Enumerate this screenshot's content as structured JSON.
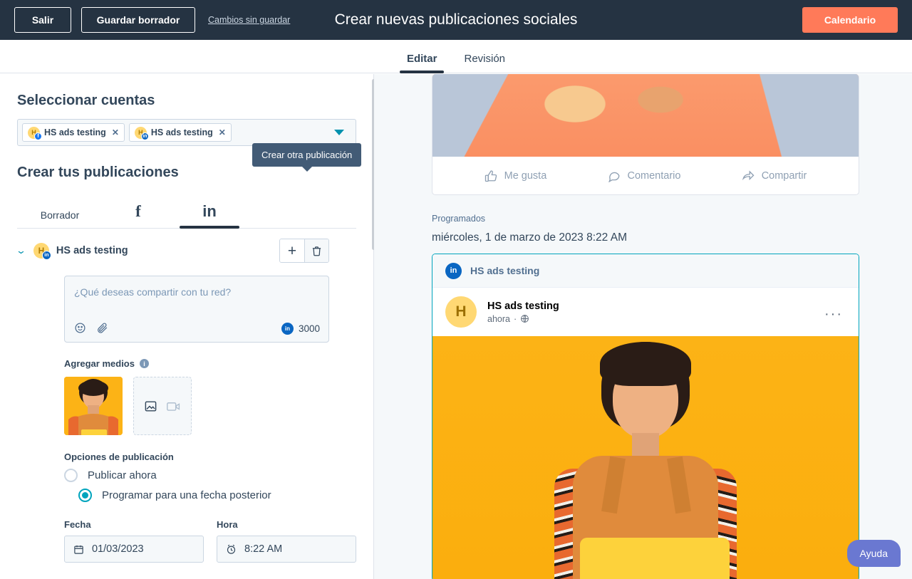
{
  "topbar": {
    "exit_label": "Salir",
    "save_draft_label": "Guardar borrador",
    "unsaved_label": "Cambios sin guardar",
    "title": "Crear nuevas publicaciones sociales",
    "calendar_label": "Calendario",
    "bg_color": "#253342",
    "accent_color": "#ff7a59"
  },
  "tabs": [
    {
      "label": "Editar",
      "active": true
    },
    {
      "label": "Revisión",
      "active": false
    }
  ],
  "left": {
    "accounts_heading": "Seleccionar cuentas",
    "chips": [
      {
        "initial": "H",
        "name": "HS ads testing",
        "network": "f",
        "close": "✕"
      },
      {
        "initial": "H",
        "name": "HS ads testing",
        "network": "in",
        "close": "✕"
      }
    ],
    "posts_heading": "Crear tus publicaciones",
    "network_tabs": [
      {
        "label": "Borrador",
        "active": false
      },
      {
        "label": "f",
        "active": false
      },
      {
        "label": "in",
        "active": true
      }
    ],
    "tooltip": "Crear otra publicación",
    "post": {
      "account_initial": "H",
      "account_badge": "in",
      "account_name": "HS ads testing",
      "add_label": "+",
      "composer_placeholder": "¿Qué deseas compartir con tu red?",
      "char_count": "3000",
      "char_network": "in"
    },
    "media": {
      "label": "Agregar medios",
      "info": "i"
    },
    "options": {
      "label": "Opciones de publicación",
      "publish_now": "Publicar ahora",
      "schedule_later": "Programar para una fecha posterior",
      "selected": "schedule_later"
    },
    "date": {
      "date_label": "Fecha",
      "date_value": "01/03/2023",
      "time_label": "Hora",
      "time_value": "8:22 AM"
    }
  },
  "right": {
    "engagement": [
      {
        "label": "Me gusta",
        "icon": "thumbs-up-icon"
      },
      {
        "label": "Comentario",
        "icon": "comment-icon"
      },
      {
        "label": "Compartir",
        "icon": "share-icon"
      }
    ],
    "scheduled_label": "Programados",
    "scheduled_date": "miércoles, 1 de marzo de 2023 8:22 AM",
    "preview": {
      "network_badge": "in",
      "header_name": "HS ads testing",
      "avatar_initial": "H",
      "author_name": "HS ads testing",
      "meta_time": "ahora",
      "meta_sep": "·",
      "menu": "···"
    },
    "help_label": "Ayuda"
  }
}
